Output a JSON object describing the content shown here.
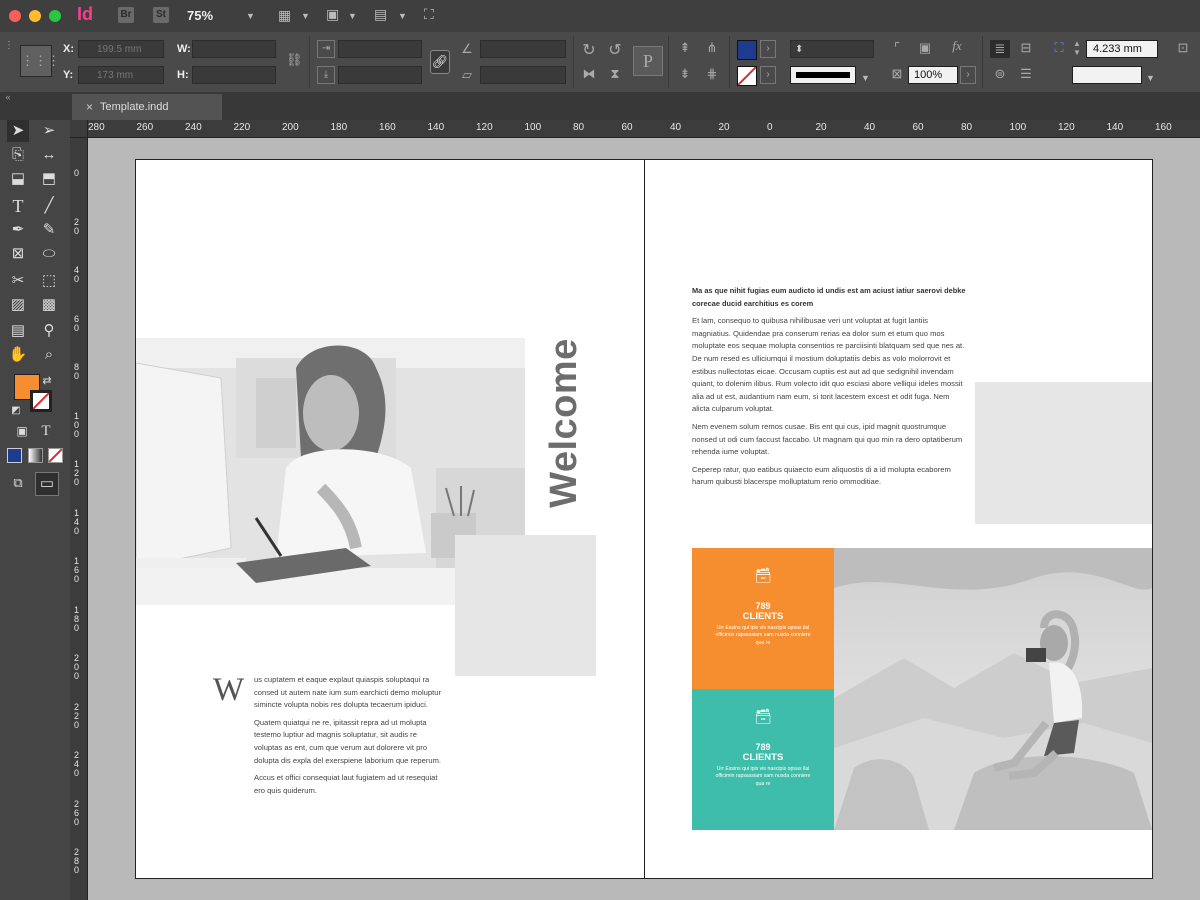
{
  "app": {
    "logo": "Id",
    "bridge_label": "Br",
    "stock_label": "St",
    "zoom": "75%"
  },
  "control_panel": {
    "x_label": "X:",
    "y_label": "Y:",
    "w_label": "W:",
    "h_label": "H:",
    "x_value": "199.5 mm",
    "y_value": "173 mm",
    "stroke_weight": "4.233 mm",
    "opacity": "100%",
    "fill_color": "#1f3b8f"
  },
  "document": {
    "tab_title": "Template.indd",
    "close_glyph": "×"
  },
  "ruler": {
    "h_ticks": [
      "280",
      "260",
      "240",
      "220",
      "200",
      "180",
      "160",
      "140",
      "120",
      "100",
      "80",
      "60",
      "40",
      "20",
      "0",
      "20",
      "40",
      "60",
      "80",
      "100",
      "120",
      "140",
      "160"
    ],
    "v_ticks": [
      "0",
      "20",
      "40",
      "60",
      "80",
      "100",
      "120",
      "140",
      "160",
      "180",
      "200",
      "220",
      "240",
      "260",
      "280"
    ]
  },
  "left_page": {
    "heading": "Welcome",
    "dropcap": "W",
    "paragraphs": [
      "us cuptatem et eaque explaut quiaspis soluptaqui ra consed ut autem nate ium sum earchicti demo moluptur simincte volupta nobis res dolupta tecaerum ipiduci.",
      "Quatem quiatqui ne re, ipitassit repra ad ut molupta testemo luptiur ad magnis soluptatur, sit audis re voluptas as ent, cum que verum aut dolorere vit pro dolupta dis expla del exerspiene laborium que reperum.",
      "Accus et offici consequiat laut fugiatem ad ut resequiat ero quis quiderum."
    ]
  },
  "right_page": {
    "intro_bold": "Ma as que nihit fugias eum audicto id undis est am aciust iatiur saerovi debke corecae ducid earchitius es corem",
    "paragraphs": [
      "Et lam, consequo to quibusa nihilibusae veri unt voluptat at fugit lantiis magniatius. Quidendae pra conserum rerias ea dolor sum et etum quo mos moluptate eos sequae molupta consentios re parciisinti blatquam sed que nes at. De num resed es ulliciumqui il mostium doluptatiis debis as volo molorrovit et estibus nullectotas eicae. Occusam cuptiis est aut ad que sedignihil invendam quiant, to dolenim ilibus. Rum volecto idit quo esciasi abore velliqui ideles mossit alia ad ut est, audantium nam eum, si torit lacestem excest et odit fuga. Nem alicta culparum voluptat.",
      "Nem evenem solum remos cusae. Bis ent qui cus, ipid magnit quostrumque nonsed ut odi cum faccust faccabo. Ut magnam qui quo min ra dero optatiberum rehenda iume voluptat.",
      "Ceperep ratur, quo eatibus quiaecto eum aliquostis di a id molupta ecaborem harum quibusti blacerspe molluptatum rerio ommoditiae."
    ],
    "stats": [
      {
        "number": "789",
        "caption": "CLIENTS",
        "text": "Urr Essins qui ipis vis nascipis opsas ilal officimin rapsassiam sam nusda conniere qua re",
        "color": "#f68d2e"
      },
      {
        "number": "789",
        "caption": "CLIENTS",
        "text": "Urr Essins qui ipis vis nascipis opsas ilal officimin rapsassiam sam nusda conniere qua re",
        "color": "#3dbdaa"
      }
    ]
  }
}
